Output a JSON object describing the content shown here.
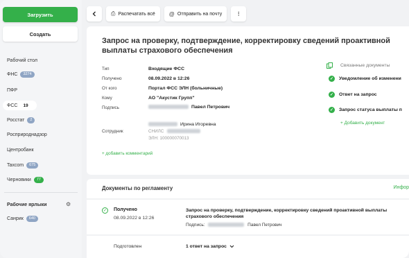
{
  "sidebar": {
    "upload_label": "Загрузить",
    "create_label": "Создать",
    "items": [
      {
        "label": "Рабочий стол",
        "badge": ""
      },
      {
        "label": "ФНС",
        "badge": "3274"
      },
      {
        "label": "ПФР",
        "badge": ""
      },
      {
        "label": "ФСС",
        "badge": "19"
      },
      {
        "label": "Росстат",
        "badge": "2"
      },
      {
        "label": "Росприроднадзор",
        "badge": ""
      },
      {
        "label": "Центробанк",
        "badge": ""
      },
      {
        "label": "Taxcom",
        "badge": "675"
      },
      {
        "label": "Черновики",
        "badge": "77"
      }
    ],
    "labels_section": "Рабочие ярлыки",
    "labels": [
      {
        "label": "Санрик",
        "badge": "640"
      }
    ]
  },
  "toolbar": {
    "print_label": "Распечатать всё",
    "email_label": "Отправить на почту"
  },
  "document": {
    "title": "Запрос на проверку, подтверждение, корректировку сведений проактивной выплаты страхового обеспечения",
    "fields": {
      "type_label": "Тип",
      "type_value": "Входящие ФСС",
      "received_label": "Получено",
      "received_value": "08.09.2022 в 12:26",
      "from_label": "От кого",
      "from_value": "Портал ФСС ЭЛН (больничные)",
      "to_label": "Кому",
      "to_value": "АО \"Акустик Групп\"",
      "sign_label": "Подпись",
      "sign_value": "Павел Петрович",
      "employee_label": "Сотрудник",
      "employee_value": "Ирина Игоревна",
      "snils_label": "СНИЛС",
      "eln_value": "ЭЛН: 100000070013"
    },
    "add_comment": "+ добавить комментарий"
  },
  "related": {
    "title": "Связанные документы",
    "items": [
      "Уведомление об изменени",
      "Ответ на запрос",
      "Запрос статуса выплаты п"
    ],
    "add": "+ Добавить документ"
  },
  "regulation": {
    "title": "Документы по регламенту",
    "info": "Инфор",
    "row": {
      "status": "Получено",
      "date": "08.09.2022 в 12:26",
      "doc_title": "Запрос на проверку, подтверждение, корректировку сведений проактивной выплаты страхового обеспечения",
      "sign_prefix": "Подпись:",
      "sign_name": "Павел Петрович"
    },
    "row2": {
      "status": "Подготовлен",
      "answers": "1 ответ на запрос"
    }
  },
  "colors": {
    "accent": "#34b04a",
    "badge": "#8fa5c4"
  }
}
